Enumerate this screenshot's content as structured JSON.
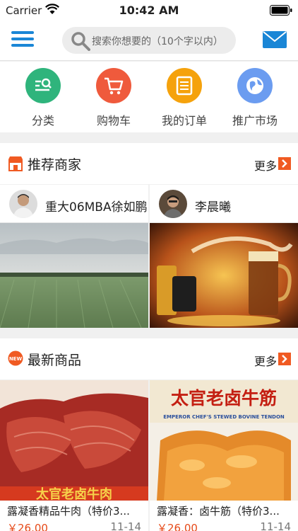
{
  "status": {
    "carrier": "Carrier",
    "time": "10:42 AM"
  },
  "search": {
    "placeholder": "搜索你想要的（10个字以内）"
  },
  "categories": [
    {
      "label": "分类",
      "icon": "category-icon",
      "color": "#2fb47c"
    },
    {
      "label": "购物车",
      "icon": "cart-icon",
      "color": "#ef5a3c"
    },
    {
      "label": "我的订单",
      "icon": "order-icon",
      "color": "#f5a20c"
    },
    {
      "label": "推广市场",
      "icon": "globe-icon",
      "color": "#6b9cf0"
    }
  ],
  "recommended": {
    "title": "推荐商家",
    "more": "更多",
    "merchants": [
      {
        "name": "重大06MBA徐如鹏"
      },
      {
        "name": "李晨曦"
      }
    ]
  },
  "latest": {
    "title": "最新商品",
    "more": "更多",
    "badge": "NEW",
    "products": [
      {
        "name": "露凝香精品牛肉（特价3...",
        "price": "￥26.00",
        "date": "11-14",
        "image_text": "太官老卤牛肉"
      },
      {
        "name": "露凝香：卤牛筋（特价3...",
        "price": "￥26.00",
        "date": "11-14",
        "image_text": "太官老卤牛筋",
        "image_subtext": "EMPEROR CHEF'S STEWED BOVINE TENDON"
      }
    ]
  },
  "colors": {
    "accent": "#1a86d6",
    "arrow": "#f05a22",
    "price": "#e64a19"
  }
}
